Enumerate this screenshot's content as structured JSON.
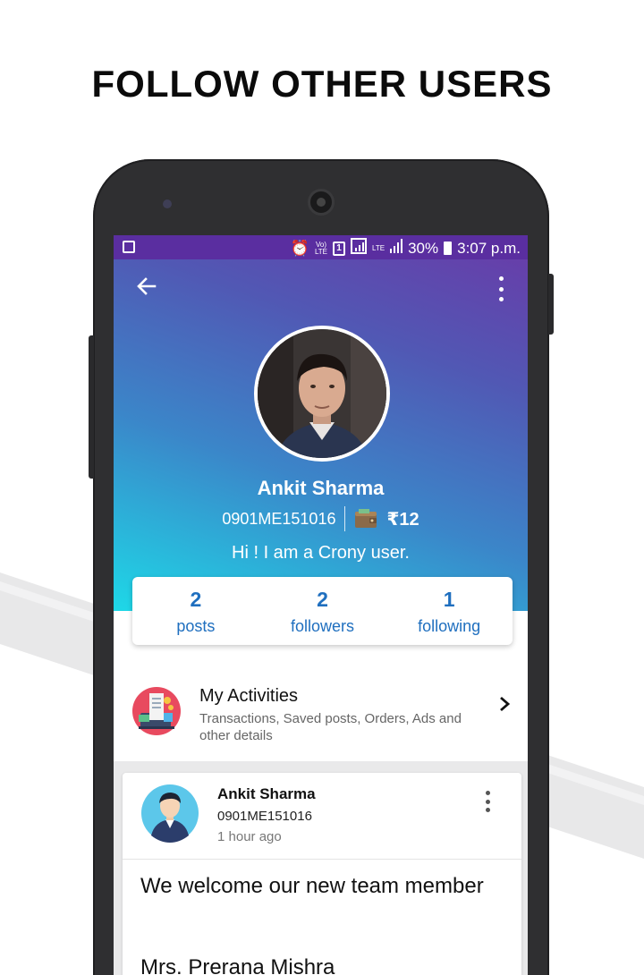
{
  "headline": "FOLLOW OTHER USERS",
  "statusbar": {
    "volte": "Vo)",
    "lte_small": "LTE",
    "sim1": "1",
    "lte": "LTE",
    "battery": "30%",
    "time": "3:07 p.m."
  },
  "profile": {
    "name": "Ankit Sharma",
    "user_id": "0901ME151016",
    "balance": "₹12",
    "bio": "Hi ! I am a Crony user."
  },
  "stats": [
    {
      "value": "2",
      "label": "posts"
    },
    {
      "value": "2",
      "label": "followers"
    },
    {
      "value": "1",
      "label": "following"
    }
  ],
  "activities": {
    "title": "My Activities",
    "description": "Transactions, Saved posts, Orders, Ads and other details"
  },
  "post": {
    "author": "Ankit Sharma",
    "author_id": "0901ME151016",
    "time": "1 hour ago",
    "text": "We welcome our new team member",
    "text2": "Mrs. Prerana Mishra"
  },
  "colors": {
    "accent": "#1f6fbf",
    "header_top": "#6a3aa8",
    "header_bottom": "#1ed8e7",
    "statusbar": "#5a2ea0"
  },
  "icons": {
    "back": "arrow-left-icon",
    "menu": "more-vertical-icon",
    "wallet": "wallet-icon",
    "activities": "activities-icon",
    "chevron": "chevron-right-icon"
  }
}
